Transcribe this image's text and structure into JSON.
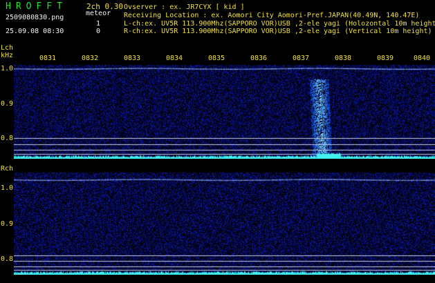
{
  "header": {
    "app_title": "HROFFT",
    "mode": "2ch 0.30",
    "file_name": "2509080830.png",
    "datetime": "25.09.08 08:30",
    "meteor_label": "meteor",
    "meteor_count_l": "1",
    "meteor_count_r": "0"
  },
  "station": {
    "observer": "Ovserver           : ex. JR7CYX [ kid ]",
    "location": "Receiving Location : ex. Aomori City Aomori-Pref.JAPAN(40.49N, 140.47E)",
    "lch": "L-ch:ex. UV5R 113.900Mhz(SAPPORO VOR)USB ,2-ele yagi (Holozontal 10m height)",
    "rch": "R-ch:ex. UV5R 113.900Mhz(SAPPORO VOR)USB ,2-ele yagi (Vertical 10m height)"
  },
  "time_axis": [
    "0831",
    "0832",
    "0833",
    "0834",
    "0835",
    "0836",
    "0837",
    "0838",
    "0839",
    "0840"
  ],
  "lch_panel": {
    "label": "Lch",
    "unit": "kHz",
    "y_ticks": [
      "1.0",
      "0.9",
      "0.8"
    ]
  },
  "rch_panel": {
    "label": "Rch",
    "y_ticks": [
      "1.0",
      "0.9",
      "0.8"
    ]
  },
  "colors": {
    "title_green": "#22e622",
    "label_yellow": "#f0e040",
    "noise_blue": "#1a2a9a",
    "signal_cyan": "#40f0f0"
  }
}
